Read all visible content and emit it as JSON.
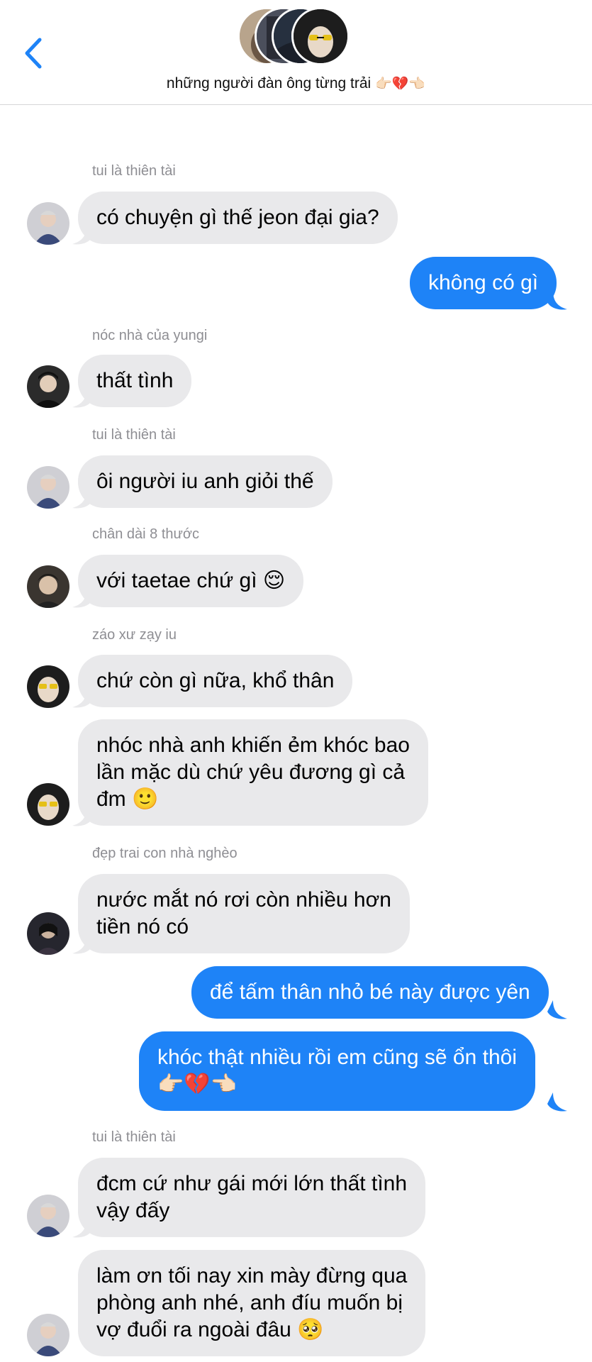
{
  "header": {
    "title": "những người đàn ông từng trải",
    "title_emoji": "👉🏻💔👈🏻",
    "back_icon": "chevron-left-icon",
    "accent": "#1e83f7"
  },
  "messages": [
    {
      "sender": "tui là thiên tài",
      "text": "có chuyện gì thế jeon đại gia?",
      "side": "in"
    },
    {
      "text": "không có gì",
      "side": "out"
    },
    {
      "sender": "nóc nhà của yungi",
      "text": "thất tình",
      "side": "in"
    },
    {
      "sender": "tui là thiên tài",
      "text": "ôi người iu anh giỏi thế",
      "side": "in"
    },
    {
      "sender": "chân dài 8 thước",
      "text": "với taetae chứ gì 😌",
      "side": "in"
    },
    {
      "sender": "záo xư zạy iu",
      "text": "chứ còn gì nữa, khổ thân",
      "side": "in"
    },
    {
      "text": "nhóc nhà anh khiến ẻm khóc bao\nlần mặc dù chứ yêu đương gì cả\nđm 🙂",
      "side": "in"
    },
    {
      "sender": "đẹp trai con nhà nghèo",
      "text": "nước mắt nó rơi còn nhiều hơn\ntiền nó có",
      "side": "in"
    },
    {
      "text": "để tấm thân nhỏ bé này được yên",
      "side": "out"
    },
    {
      "text": "khóc thật nhiều rồi em cũng sẽ ổn thôi\n👉🏻💔👈🏻",
      "side": "out"
    },
    {
      "sender": "tui là thiên tài",
      "text": "đcm cứ như gái mới lớn thất tình\nvậy đấy",
      "side": "in"
    },
    {
      "text": "làm ơn tối nay xin mày đừng qua\nphòng anh nhé, anh đíu muốn bị\nvợ đuổi ra ngoài đâu 🥺",
      "side": "in"
    }
  ]
}
